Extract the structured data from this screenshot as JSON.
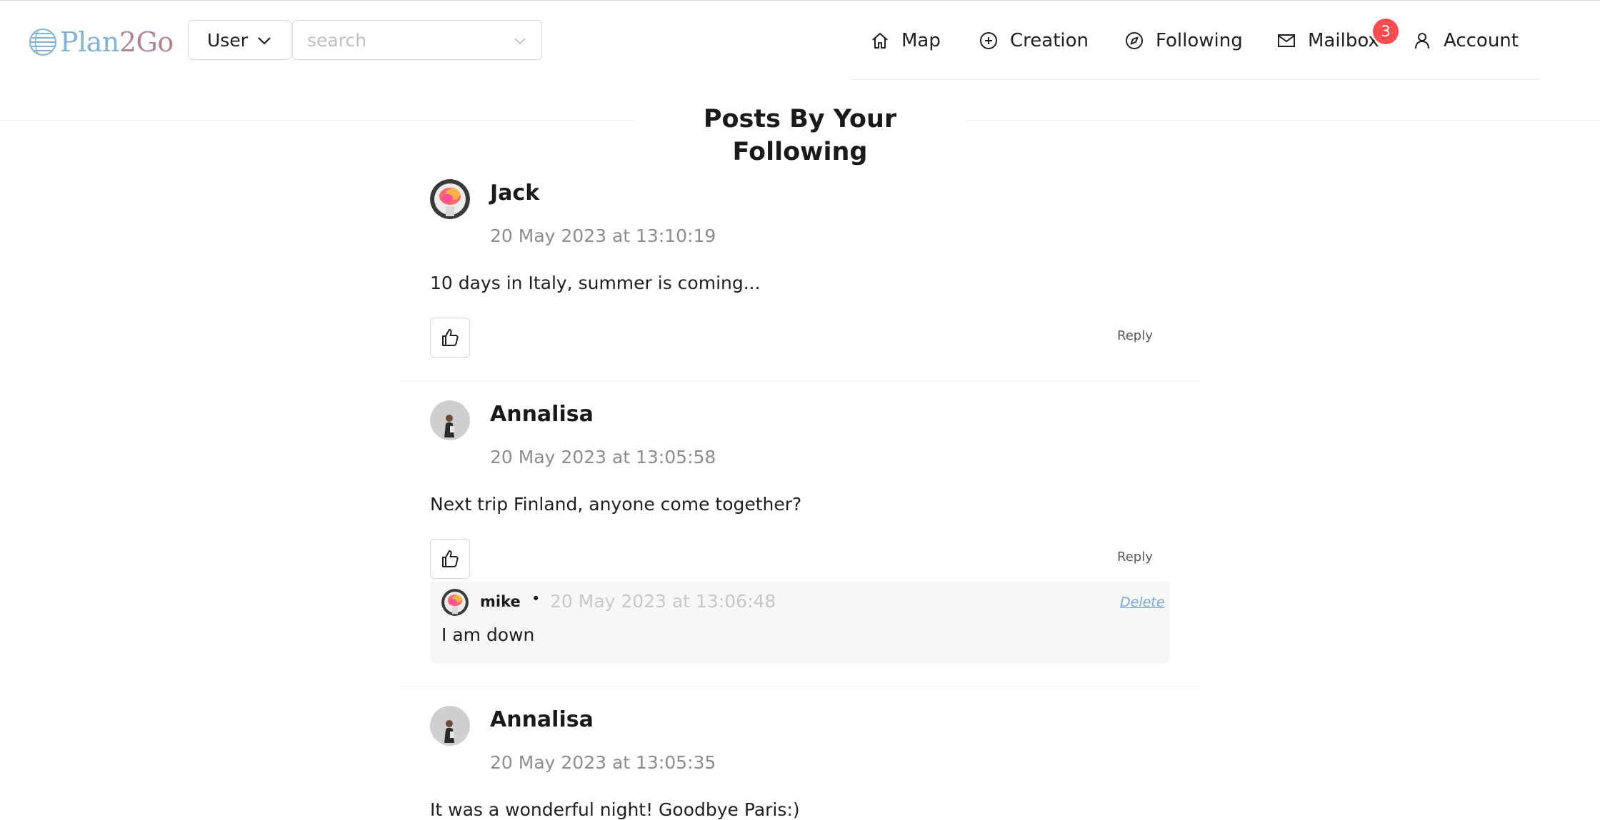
{
  "header": {
    "logo": {
      "part1": "Plan",
      "part2": "2Go"
    },
    "search_type": {
      "value": "User"
    },
    "search": {
      "placeholder": "search"
    },
    "nav": [
      {
        "label": "Map",
        "icon": "home-icon"
      },
      {
        "label": "Creation",
        "icon": "plus-circle-icon"
      },
      {
        "label": "Following",
        "icon": "compass-icon"
      },
      {
        "label": "Mailbox",
        "icon": "mail-icon",
        "badge": "3"
      },
      {
        "label": "Account",
        "icon": "user-icon"
      }
    ]
  },
  "page": {
    "title": "Posts By Your Following"
  },
  "posts": [
    {
      "author": "Jack",
      "time": "20 May 2023 at 13:10:19",
      "content": "10 days in Italy, summer is coming...",
      "reply_label": "Reply",
      "avatar": "colorful-avatar"
    },
    {
      "author": "Annalisa",
      "time": "20 May 2023 at 13:05:58",
      "content": "Next trip Finland, anyone come together?",
      "reply_label": "Reply",
      "avatar": "person-avatar",
      "comments": [
        {
          "author": "mike",
          "separator": "•",
          "time": "20 May 2023 at 13:06:48",
          "text": "I am down",
          "delete_label": "Delete",
          "avatar": "colorful-avatar"
        }
      ]
    },
    {
      "author": "Annalisa",
      "time": "20 May 2023 at 13:05:35",
      "content": "It was a wonderful night! Goodbye Paris:)",
      "avatar": "person-avatar"
    }
  ],
  "colors": {
    "badge": "#ff4d4f",
    "muted_text": "#8c8c8c",
    "delete_link": "#7ba7d9"
  }
}
